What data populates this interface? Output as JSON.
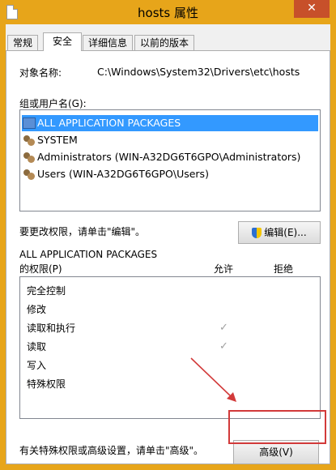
{
  "window": {
    "title": "hosts 属性",
    "close_glyph": "✕"
  },
  "tabs": [
    {
      "label": "常规",
      "active": false
    },
    {
      "label": "安全",
      "active": true
    },
    {
      "label": "详细信息",
      "active": false
    },
    {
      "label": "以前的版本",
      "active": false
    }
  ],
  "object": {
    "label": "对象名称:",
    "value": "C:\\Windows\\System32\\Drivers\\etc\\hosts"
  },
  "groups": {
    "label": "组或用户名(G):",
    "items": [
      {
        "label": "ALL APPLICATION PACKAGES",
        "icon": "package-icon",
        "selected": true
      },
      {
        "label": "SYSTEM",
        "icon": "people-icon",
        "selected": false
      },
      {
        "label": "Administrators (WIN-A32DG6T6GPO\\Administrators)",
        "icon": "people-icon",
        "selected": false
      },
      {
        "label": "Users (WIN-A32DG6T6GPO\\Users)",
        "icon": "people-icon",
        "selected": false
      }
    ]
  },
  "edit": {
    "hint": "要更改权限，请单击\"编辑\"。",
    "button_label": "编辑(E)..."
  },
  "permissions": {
    "title": "ALL APPLICATION PACKAGES",
    "subtitle": "的权限(P)",
    "allow_header": "允许",
    "deny_header": "拒绝",
    "check_glyph": "✓",
    "rows": [
      {
        "label": "完全控制",
        "allow": false,
        "deny": false
      },
      {
        "label": "修改",
        "allow": false,
        "deny": false
      },
      {
        "label": "读取和执行",
        "allow": true,
        "deny": false
      },
      {
        "label": "读取",
        "allow": true,
        "deny": false
      },
      {
        "label": "写入",
        "allow": false,
        "deny": false
      },
      {
        "label": "特殊权限",
        "allow": false,
        "deny": false
      }
    ]
  },
  "advanced": {
    "hint": "有关特殊权限或高级设置，请单击\"高级\"。",
    "button_label": "高级(V)"
  },
  "colors": {
    "title_bar": "#e7a51a",
    "close": "#c7502a",
    "selection": "#3399ff",
    "annotation": "#d23a3a"
  }
}
